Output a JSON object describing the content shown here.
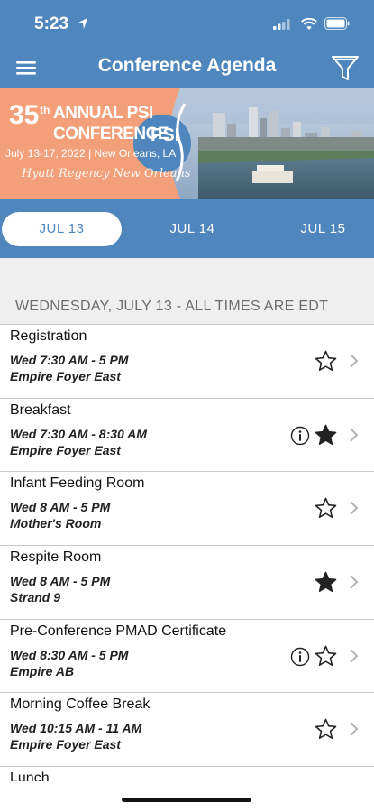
{
  "status": {
    "time": "5:23"
  },
  "nav": {
    "title": "Conference Agenda",
    "menu_icon": "hamburger-menu-icon",
    "filter_icon": "funnel-filter-icon"
  },
  "banner": {
    "number": "35",
    "ordinal": "th",
    "line1": "ANNUAL PSI",
    "line2": "CONFERENCE",
    "dates": "July 13-17, 2022 | New Orleans, LA",
    "script": "Hyatt Regency New Orleans",
    "logo": "PSI"
  },
  "date_tabs": [
    {
      "label": "JUL 13",
      "active": true
    },
    {
      "label": "JUL 14",
      "active": false
    },
    {
      "label": "JUL 15",
      "active": false
    }
  ],
  "section_header": "WEDNESDAY, JULY 13 - ALL TIMES ARE EDT",
  "sessions": [
    {
      "title": "Registration",
      "time": "Wed 7:30 AM - 5 PM",
      "location": "Empire Foyer East",
      "info": false,
      "starred": false
    },
    {
      "title": "Breakfast",
      "time": "Wed 7:30 AM - 8:30 AM",
      "location": "Empire Foyer East",
      "info": true,
      "starred": true
    },
    {
      "title": "Infant Feeding Room",
      "time": "Wed 8 AM - 5 PM",
      "location": "Mother's Room",
      "info": false,
      "starred": false
    },
    {
      "title": "Respite Room",
      "time": "Wed 8 AM - 5 PM",
      "location": "Strand 9",
      "info": false,
      "starred": true
    },
    {
      "title": "Pre-Conference PMAD Certificate",
      "time": "Wed 8:30 AM - 5 PM",
      "location": "Empire AB",
      "info": true,
      "starred": false
    },
    {
      "title": "Morning Coffee Break",
      "time": "Wed 10:15 AM - 11 AM",
      "location": "Empire Foyer East",
      "info": false,
      "starred": false
    },
    {
      "title": "Lunch"
    }
  ],
  "colors": {
    "primary": "#4f86bd",
    "banner": "#f3a07a",
    "background": "#efefef"
  }
}
